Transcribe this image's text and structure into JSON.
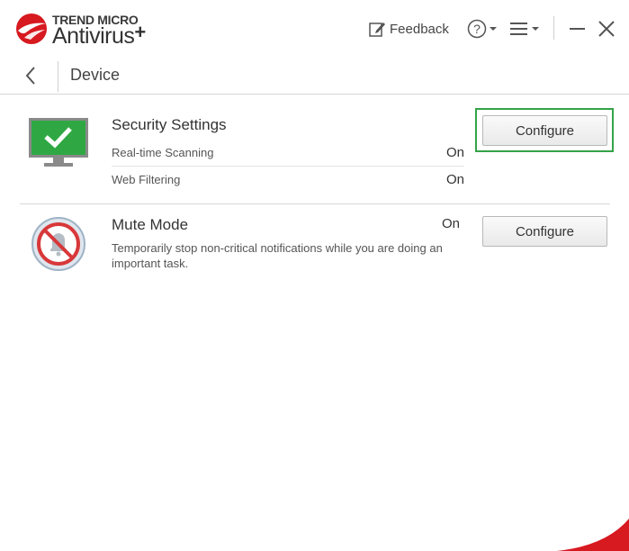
{
  "app": {
    "brand_top": "TREND MICRO",
    "brand_name": "Antivirus",
    "brand_plus": "+",
    "accent_color": "#d71920"
  },
  "toolbar": {
    "feedback_label": "Feedback",
    "feedback_icon": "feedback-edit-icon",
    "help_icon": "help-circle-icon",
    "menu_icon": "hamburger-menu-icon",
    "minimize_icon": "minimize-icon",
    "close_icon": "close-icon"
  },
  "nav": {
    "back_icon": "chevron-left-icon",
    "title": "Device"
  },
  "security": {
    "icon": "monitor-check-icon",
    "title": "Security Settings",
    "rows": [
      {
        "label": "Real-time Scanning",
        "value": "On"
      },
      {
        "label": "Web Filtering",
        "value": "On"
      }
    ],
    "button_label": "Configure"
  },
  "mute": {
    "icon": "muted-bell-icon",
    "title": "Mute Mode",
    "value": "On",
    "description": "Temporarily stop non-critical notifications while you are doing an important task.",
    "button_label": "Configure"
  },
  "colors": {
    "focus_ring": "#34a347",
    "monitor_green": "#2fa843"
  }
}
